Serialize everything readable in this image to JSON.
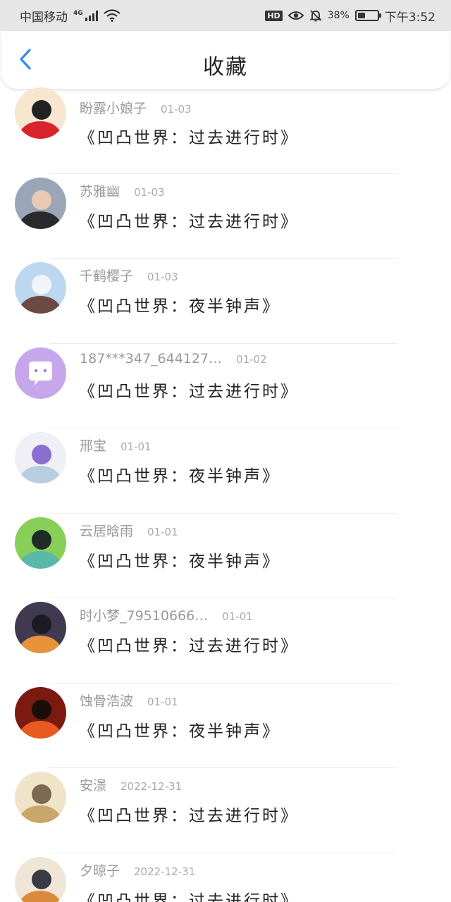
{
  "status_bar": {
    "carrier": "中国移动",
    "network": "4G",
    "hd": "HD",
    "battery_percent": "38%",
    "battery_level": 0.38,
    "time": "下午3:52",
    "icons": [
      "signal-icon",
      "wifi-icon",
      "eye-icon",
      "bell-off-icon",
      "battery-icon"
    ]
  },
  "header": {
    "back_icon": "chevron-left-icon",
    "title": "收藏",
    "accent_color": "#2b8ef0"
  },
  "favorites": [
    {
      "username": "盼露小娘子",
      "date": "01-03",
      "book": "《凹凸世界：过去进行时》",
      "avatar_colors": [
        "#f7e7d0",
        "#d8242b",
        "#222222"
      ]
    },
    {
      "username": "苏雅幽",
      "date": "01-03",
      "book": "《凹凸世界：过去进行时》",
      "avatar_colors": [
        "#9aa6b8",
        "#2a2a2e",
        "#e8c9b2"
      ]
    },
    {
      "username": "千鹤樱子",
      "date": "01-03",
      "book": "《凹凸世界：夜半钟声》",
      "avatar_colors": [
        "#bcd7ef",
        "#6b4a43",
        "#f1f5fa"
      ]
    },
    {
      "username": "187***347_644127…",
      "date": "01-02",
      "book": "《凹凸世界：过去进行时》",
      "avatar_colors": [
        "#c7a7ec",
        "#ffffff",
        "#9c79d6"
      ]
    },
    {
      "username": "邢宝",
      "date": "01-01",
      "book": "《凹凸世界：夜半钟声》",
      "avatar_colors": [
        "#eef0f6",
        "#b8cde0",
        "#8a6fd0"
      ]
    },
    {
      "username": "云居晗雨",
      "date": "01-01",
      "book": "《凹凸世界：夜半钟声》",
      "avatar_colors": [
        "#88cf5a",
        "#5ab8a8",
        "#1f2b25"
      ]
    },
    {
      "username": "时小梦_79510666…",
      "date": "01-01",
      "book": "《凹凸世界：过去进行时》",
      "avatar_colors": [
        "#3f3a4f",
        "#e8933a",
        "#1c1a22"
      ]
    },
    {
      "username": "蚀骨浩波",
      "date": "01-01",
      "book": "《凹凸世界：夜半钟声》",
      "avatar_colors": [
        "#7a1a10",
        "#e85a20",
        "#1a0d0a"
      ]
    },
    {
      "username": "安澋",
      "date": "2022-12-31",
      "book": "《凹凸世界：过去进行时》",
      "avatar_colors": [
        "#efe4c8",
        "#c9a66a",
        "#7d6a52"
      ]
    },
    {
      "username": "夕晾子",
      "date": "2022-12-31",
      "book": "《凹凸世界：过去进行时》",
      "avatar_colors": [
        "#f0e6d8",
        "#d98a3a",
        "#3a3a44"
      ]
    }
  ]
}
